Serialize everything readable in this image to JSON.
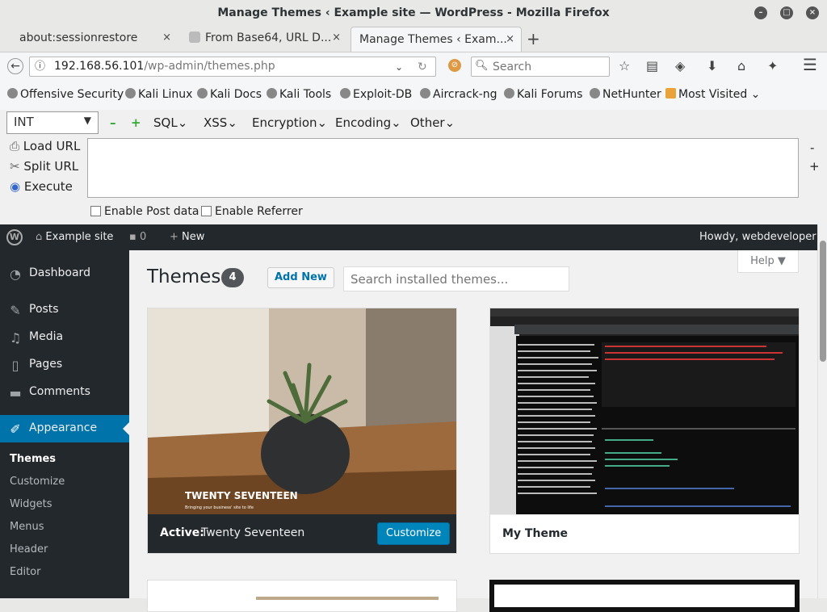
{
  "window": {
    "title": "Manage Themes ‹ Example site — WordPress - Mozilla Firefox",
    "minimize": "–",
    "maximize": "□",
    "close": "×"
  },
  "tabs": [
    {
      "label": "about:sessionrestore",
      "close": "×"
    },
    {
      "label": "From Base64, URL D...",
      "close": "×"
    },
    {
      "label": "Manage Themes ‹ Exam...",
      "close": "×"
    }
  ],
  "newtab": "+",
  "nav": {
    "url_host": "192.168.56.101",
    "url_path": "/wp-admin/themes.php",
    "search_placeholder": "Search"
  },
  "bookmarks": [
    "Offensive Security",
    "Kali Linux",
    "Kali Docs",
    "Kali Tools",
    "Exploit-DB",
    "Aircrack-ng",
    "Kali Forums",
    "NetHunter",
    "Most Visited"
  ],
  "hackbar": {
    "int": "INT",
    "minus": "–",
    "plus": "+",
    "menus": [
      "SQL",
      "XSS",
      "Encryption",
      "Encoding",
      "Other"
    ],
    "load": "Load URL",
    "split": "Split URL",
    "execute": "Execute",
    "post": "Enable Post data",
    "referrer": "Enable Referrer",
    "side_minus": "-",
    "side_plus": "+"
  },
  "adminbar": {
    "site": "Example site",
    "comments": "0",
    "new": "New",
    "howdy": "Howdy, webdeveloper"
  },
  "sidebar": {
    "items": [
      "Dashboard",
      "Posts",
      "Media",
      "Pages",
      "Comments",
      "Appearance"
    ],
    "sub": [
      "Themes",
      "Customize",
      "Widgets",
      "Menus",
      "Header",
      "Editor"
    ]
  },
  "main": {
    "title": "Themes",
    "count": "4",
    "add_new": "Add New",
    "search_placeholder": "Search installed themes...",
    "help": "Help ▼",
    "active_label": "Active:",
    "active_name": "Twenty Seventeen",
    "customize": "Customize",
    "theme2": "My Theme",
    "ts_logo": "TWENTY SEVENTEEN",
    "ts_tagline": "Bringing your business' site to life"
  },
  "colors": {
    "wp_blue": "#0073aa",
    "admin_dark": "#23282d"
  }
}
